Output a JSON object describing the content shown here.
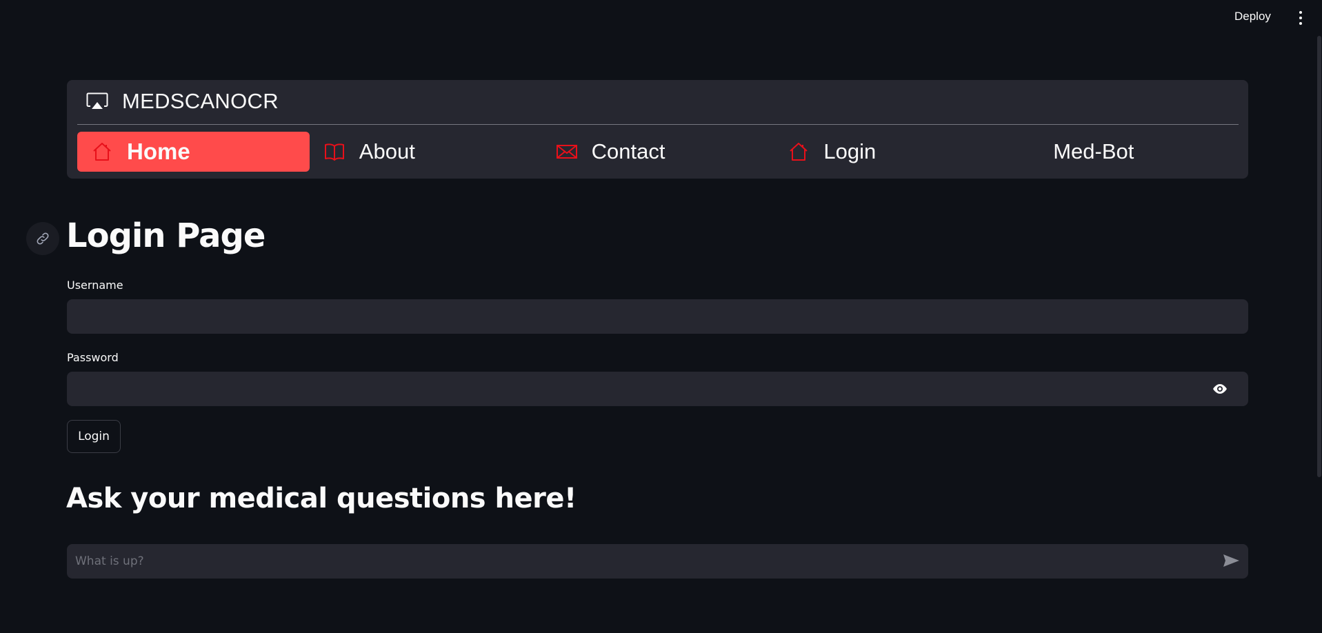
{
  "topbar": {
    "deploy_label": "Deploy",
    "menu_icon": "vertical-ellipsis-icon"
  },
  "navbar": {
    "brand": {
      "title": "MEDSCANOCR",
      "icon": "airplay-icon"
    },
    "items": [
      {
        "label": "Home",
        "icon": "house-icon",
        "active": true
      },
      {
        "label": "About",
        "icon": "book-icon",
        "active": false
      },
      {
        "label": "Contact",
        "icon": "envelope-icon",
        "active": false
      },
      {
        "label": "Login",
        "icon": "house-icon",
        "active": false
      },
      {
        "label": "Med-Bot",
        "icon": "",
        "active": false
      }
    ],
    "accent_color": "#ff4b4b",
    "icon_color": "#e8101a"
  },
  "login": {
    "title": "Login Page",
    "username_label": "Username",
    "username_value": "",
    "password_label": "Password",
    "password_value": "",
    "submit_label": "Login"
  },
  "chat": {
    "heading": "Ask your medical questions here!",
    "placeholder": "What is up?"
  },
  "colors": {
    "background": "#0e1117",
    "surface": "#262730",
    "text": "#fafafa"
  }
}
